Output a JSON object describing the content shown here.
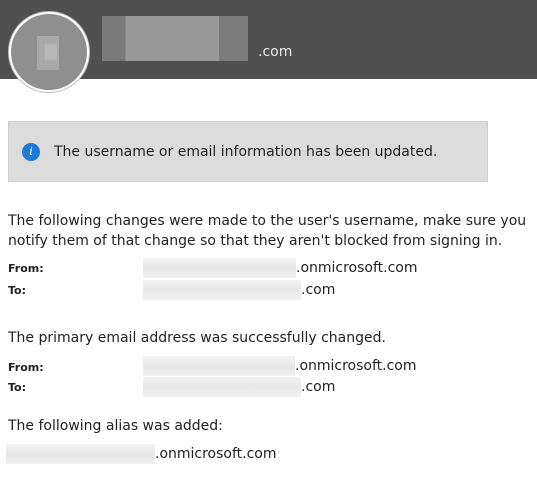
{
  "header": {
    "domain_suffix": ".com"
  },
  "banner": {
    "icon": "info-icon",
    "message": "The username or email information has been updated."
  },
  "username_section": {
    "line1": "The following changes were made to the user's username, make sure you",
    "line2": "notify them of that change so that they aren't blocked from signing in.",
    "from_label": "From:",
    "from_domain": ".onmicrosoft.com",
    "to_label": "To:",
    "to_domain": ".com"
  },
  "email_section": {
    "text": "The primary email address was successfully changed.",
    "from_label": "From:",
    "from_domain": ".onmicrosoft.com",
    "to_label": "To:",
    "to_domain": ".com"
  },
  "alias_section": {
    "text": "The following alias was added:",
    "alias_domain": ".onmicrosoft.com"
  },
  "colors": {
    "header_bg": "#505050",
    "banner_bg": "#dcdcdc",
    "info_blue": "#1e7ad3"
  }
}
